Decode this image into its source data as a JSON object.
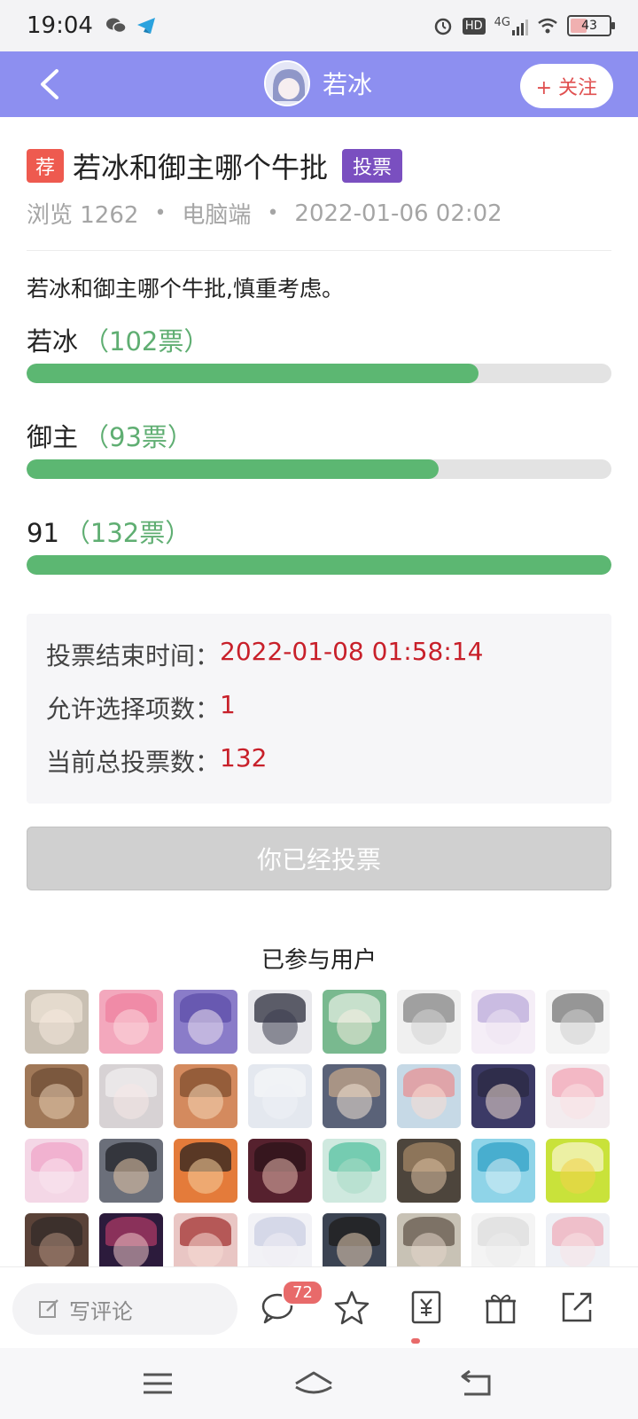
{
  "status_bar": {
    "time": "19:04",
    "network": "4G",
    "battery": "43",
    "hd_label": "HD"
  },
  "header": {
    "username": "若冰",
    "follow_label": "+ 关注"
  },
  "post": {
    "recommend_badge": "荐",
    "title": "若冰和御主哪个牛批",
    "type_badge": "投票",
    "views_label": "浏览 1262",
    "platform": "电脑端",
    "datetime": "2022-01-06 02:02",
    "separator": "•",
    "description": "若冰和御主哪个牛批,慎重考虑。"
  },
  "vote": {
    "options": [
      {
        "name": "若冰",
        "count_label": "（102票）",
        "votes": 102,
        "fill": 0.773
      },
      {
        "name": "御主",
        "count_label": "（93票）",
        "votes": 93,
        "fill": 0.704
      },
      {
        "name": "91",
        "count_label": "（132票）",
        "votes": 132,
        "fill": 1.0
      }
    ],
    "info": {
      "end_label": "投票结束时间：",
      "end_value": "2022-01-08 01:58:14",
      "allowed_label": "允许选择项数：",
      "allowed_value": "1",
      "total_label": "当前总投票数：",
      "total_value": "132"
    },
    "voted_button": "你已经投票"
  },
  "participants": {
    "title": "已参与用户",
    "avatars": [
      {
        "bg": "#c9c0b3",
        "hair": "#efe6d9",
        "face": "#f5e9df"
      },
      {
        "bg": "#f3a8bd",
        "hair": "#ee7f9e",
        "face": "#fbd9df"
      },
      {
        "bg": "#8a7cc9",
        "hair": "#5a4aa6",
        "face": "#efe3f0"
      },
      {
        "bg": "#e8e8ec",
        "hair": "#1f2130",
        "face": "#3a3d4f"
      },
      {
        "bg": "#79b98f",
        "hair": "#e8f1e6",
        "face": "#f6efe2"
      },
      {
        "bg": "#f0f0f0",
        "hair": "#7d7d7d",
        "face": "#d4d4d4"
      },
      {
        "bg": "#f5eef7",
        "hair": "#b8a6d9",
        "face": "#ece4f3"
      },
      {
        "bg": "#f4f4f4",
        "hair": "#6e6e6e",
        "face": "#cfcfcf"
      },
      {
        "bg": "#a07858",
        "hair": "#6b4a33",
        "face": "#e8cdb3"
      },
      {
        "bg": "#d7d2d4",
        "hair": "#f2f0f1",
        "face": "#f6e8e6"
      },
      {
        "bg": "#d48a5e",
        "hair": "#7a4a2b",
        "face": "#f4d7b8"
      },
      {
        "bg": "#e4e8ef",
        "hair": "#f7f8fa",
        "face": "#eef0f5"
      },
      {
        "bg": "#5a6278",
        "hair": "#c9a98a",
        "face": "#f1e2d4"
      },
      {
        "bg": "#c6d9e6",
        "hair": "#e98d8f",
        "face": "#f9dcd2"
      },
      {
        "bg": "#3c3a66",
        "hair": "#2a2840",
        "face": "#f0dcd2"
      },
      {
        "bg": "#f3ecef",
        "hair": "#f2a3b4",
        "face": "#f9e1e4"
      },
      {
        "bg": "#f4d7e6",
        "hair": "#f0a2c6",
        "face": "#f9e6ee"
      },
      {
        "bg": "#6b6f7a",
        "hair": "#1c1e24",
        "face": "#e5c6a8"
      },
      {
        "bg": "#e47b3a",
        "hair": "#1e1c1c",
        "face": "#f5cf9e"
      },
      {
        "bg": "#56212e",
        "hair": "#2a1218",
        "face": "#e7b9ae"
      },
      {
        "bg": "#cfe9df",
        "hair": "#4fbf9c",
        "face": "#a8dbc5"
      },
      {
        "bg": "#4d453c",
        "hair": "#a88a66",
        "face": "#dcc0a3"
      },
      {
        "bg": "#8fd4e8",
        "hair": "#2a9ec4",
        "face": "#d9eff5"
      },
      {
        "bg": "#c9e23a",
        "hair": "#fbf7d0",
        "face": "#f2d24a"
      },
      {
        "bg": "#5a4238",
        "hair": "#2f2a28",
        "face": "#b18f7d"
      },
      {
        "bg": "#2c1b3c",
        "hair": "#b23a66",
        "face": "#f0c7c8"
      },
      {
        "bg": "#e9c6c4",
        "hair": "#9e2a2a",
        "face": "#f6dad4"
      },
      {
        "bg": "#f2f2f6",
        "hair": "#c9cde2",
        "face": "#f1eef4"
      },
      {
        "bg": "#3b4352",
        "hair": "#1d1a18",
        "face": "#e7cdb4"
      },
      {
        "bg": "#c8c2b5",
        "hair": "#5d5045",
        "face": "#e3d6c8"
      },
      {
        "bg": "#f4f4f4",
        "hair": "#dcdcdc",
        "face": "#ececec"
      },
      {
        "bg": "#eef0f5",
        "hair": "#f0a9b8",
        "face": "#f8e3e5"
      }
    ]
  },
  "bottom_bar": {
    "comment_placeholder": "写评论",
    "comment_count": "72",
    "icons": [
      "comment-icon",
      "star-icon",
      "yuan-icon",
      "gift-icon",
      "share-icon"
    ]
  },
  "system_nav": {
    "icons": [
      "menu-icon",
      "home-icon",
      "back-icon"
    ]
  }
}
